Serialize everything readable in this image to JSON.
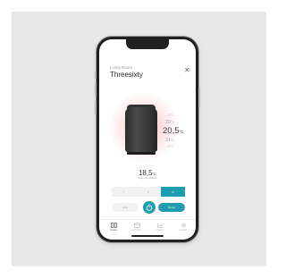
{
  "header": {
    "subtitle": "Living Room",
    "title": "Threesixty"
  },
  "temperature_scale": [
    {
      "value": "22",
      "unit": "°C"
    },
    {
      "value": "20",
      "unit": "°C"
    },
    {
      "value": "20,5",
      "unit": "°C"
    },
    {
      "value": "21",
      "unit": "°C"
    },
    {
      "value": "22",
      "unit": "°C"
    }
  ],
  "target": {
    "value": "18,5",
    "unit": "°C",
    "label": "Target temperature"
  },
  "speed": {
    "options": [
      "I",
      "II",
      "III"
    ],
    "selected": "III"
  },
  "controls": {
    "eco_label": "Eco",
    "boost_label": "Boost"
  },
  "tabs": [
    {
      "label": "Heater",
      "icon": "heater-icon",
      "active": true
    },
    {
      "label": "Schedule",
      "icon": "calendar-icon",
      "active": false
    },
    {
      "label": "History",
      "icon": "chart-icon",
      "active": false
    },
    {
      "label": "Settings",
      "icon": "gear-icon",
      "active": false
    }
  ],
  "colors": {
    "accent": "#1e9db1",
    "glow": "#f07878",
    "text": "#3c3c3c",
    "muted": "#c8c8c8",
    "backdrop": "#e8e8e8"
  }
}
